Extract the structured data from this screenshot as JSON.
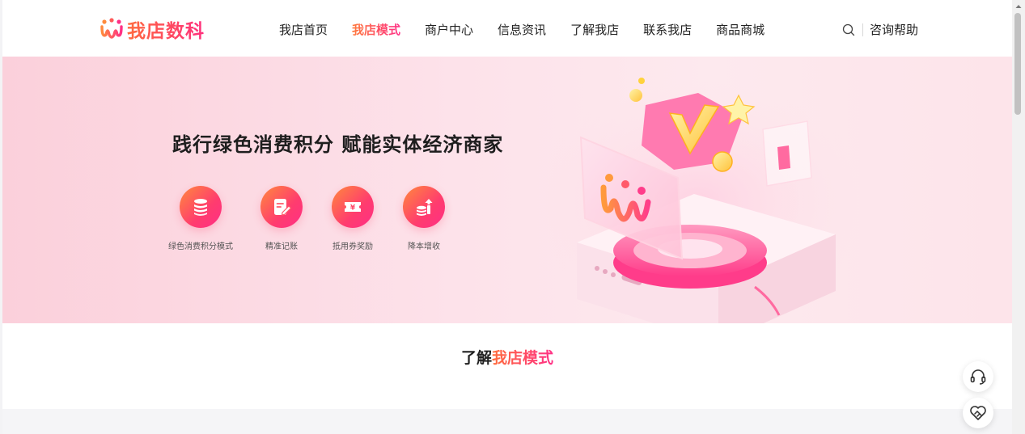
{
  "header": {
    "logo_text": "我店数科",
    "nav": [
      {
        "label": "我店首页",
        "active": false
      },
      {
        "label": "我店模式",
        "active": true
      },
      {
        "label": "商户中心",
        "active": false
      },
      {
        "label": "信息资讯",
        "active": false
      },
      {
        "label": "了解我店",
        "active": false
      },
      {
        "label": "联系我店",
        "active": false
      },
      {
        "label": "商品商城",
        "active": false
      }
    ],
    "help_label": "咨询帮助",
    "search_icon": "search-icon"
  },
  "banner": {
    "title": "践行绿色消费积分 赋能实体经济商家",
    "features": [
      {
        "label": "绿色消费积分模式",
        "icon": "coin-stack-icon"
      },
      {
        "label": "精准记账",
        "icon": "edit-document-icon"
      },
      {
        "label": "抵用券奖励",
        "icon": "coupon-icon"
      },
      {
        "label": "降本增收",
        "icon": "growth-coins-icon"
      }
    ]
  },
  "section": {
    "title_plain": "了解",
    "title_accent": "我店模式"
  },
  "floating": {
    "service_icon": "headset-icon",
    "cooperate_icon": "handshake-icon"
  },
  "colors": {
    "brand_start": "#ff7a3c",
    "brand_end": "#ff2f86",
    "banner_bg": "#fde2ea"
  }
}
